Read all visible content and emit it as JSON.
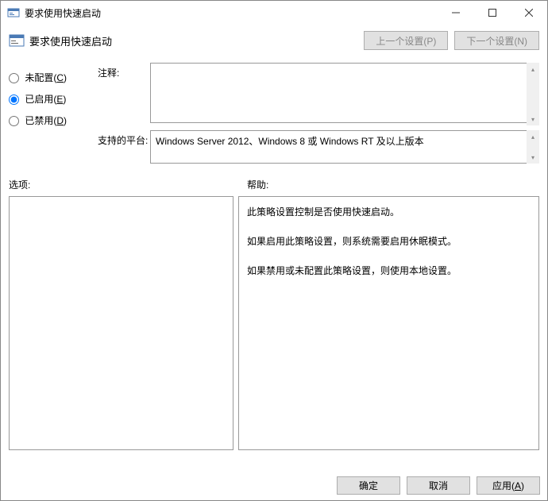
{
  "window": {
    "title": "要求使用快速启动"
  },
  "header": {
    "title": "要求使用快速启动",
    "prev": "上一个设置(P)",
    "next": "下一个设置(N)"
  },
  "radios": {
    "not_configured": "未配置(C)",
    "enabled": "已启用(E)",
    "disabled": "已禁用(D)",
    "selected": "enabled"
  },
  "fields": {
    "comment_label": "注释:",
    "comment_value": "",
    "platform_label": "支持的平台:",
    "platform_value": "Windows Server 2012、Windows 8 或 Windows RT 及以上版本"
  },
  "labels": {
    "options": "选项:",
    "help": "帮助:"
  },
  "help": {
    "p1": "此策略设置控制是否使用快速启动。",
    "p2": "如果启用此策略设置，则系统需要启用休眠模式。",
    "p3": "如果禁用或未配置此策略设置，则使用本地设置。"
  },
  "footer": {
    "ok": "确定",
    "cancel": "取消",
    "apply": "应用(A)"
  }
}
